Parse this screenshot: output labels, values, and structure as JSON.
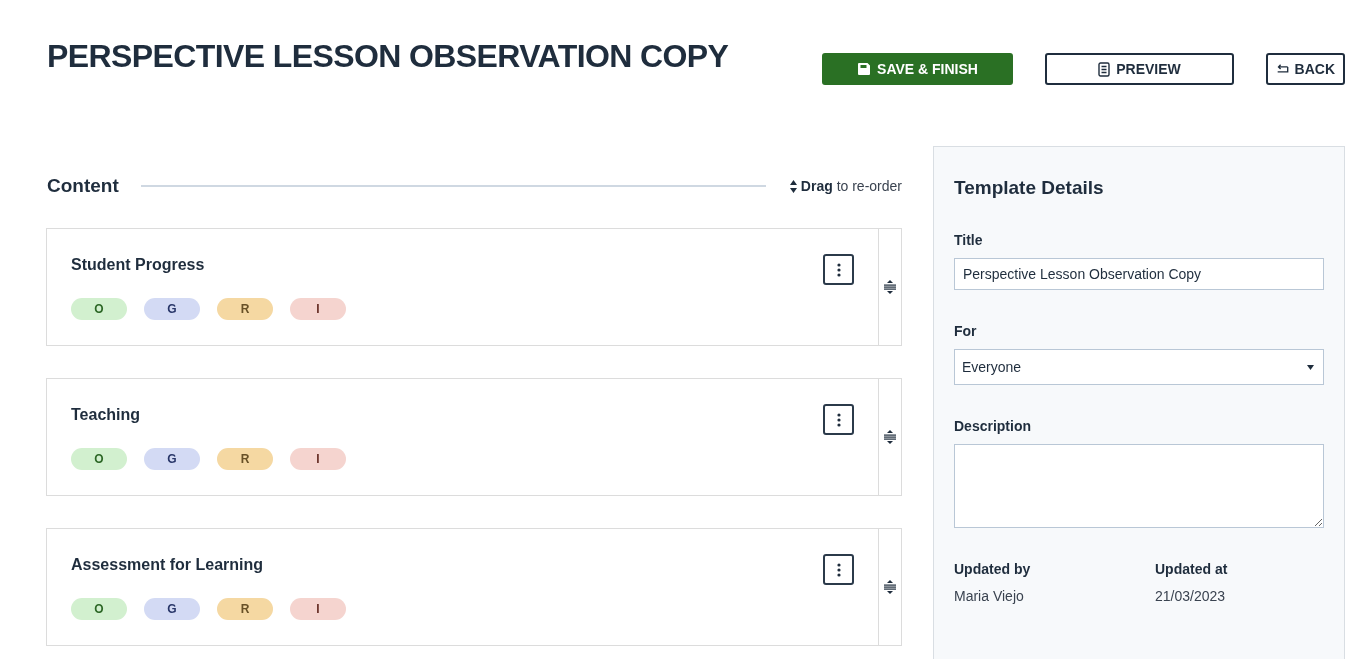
{
  "page": {
    "title": "PERSPECTIVE LESSON OBSERVATION COPY"
  },
  "actions": [
    {
      "kind": "save",
      "label": "SAVE & FINISH"
    },
    {
      "kind": "preview",
      "label": "PREVIEW"
    },
    {
      "kind": "back",
      "label": "BACK"
    }
  ],
  "content": {
    "heading": "Content",
    "reorder_hint": "**Drag** to re-order",
    "sections": [
      {
        "title": "Student Progress",
        "tags": [
          {
            "label": "O",
            "color": "#d2f0cf"
          },
          {
            "label": "G",
            "color": "#d3daf4"
          },
          {
            "label": "R",
            "color": "#f5d8a2"
          },
          {
            "label": "I",
            "color": "#f5d4cf"
          }
        ]
      },
      {
        "title": "Teaching",
        "tags": [
          {
            "label": "O",
            "color": "#d2f0cf"
          },
          {
            "label": "G",
            "color": "#d3daf4"
          },
          {
            "label": "R",
            "color": "#f5d8a2"
          },
          {
            "label": "I",
            "color": "#f5d4cf"
          }
        ]
      },
      {
        "title": "Assessment for Learning",
        "tags": [
          {
            "label": "O",
            "color": "#d2f0cf"
          },
          {
            "label": "G",
            "color": "#d3daf4"
          },
          {
            "label": "R",
            "color": "#f5d8a2"
          },
          {
            "label": "I",
            "color": "#f5d4cf"
          }
        ]
      }
    ]
  },
  "template_details": {
    "heading": "Template Details",
    "fields": [
      {
        "kind": "text",
        "label": "Title",
        "value": "Perspective Lesson Observation Copy"
      },
      {
        "kind": "select",
        "label": "For",
        "value": "Everyone"
      },
      {
        "kind": "textarea",
        "label": "Description"
      }
    ],
    "meta": [
      {
        "label": "Updated by",
        "value": "Maria Viejo"
      },
      {
        "label": "Updated at",
        "value": "21/03/2023"
      }
    ]
  }
}
